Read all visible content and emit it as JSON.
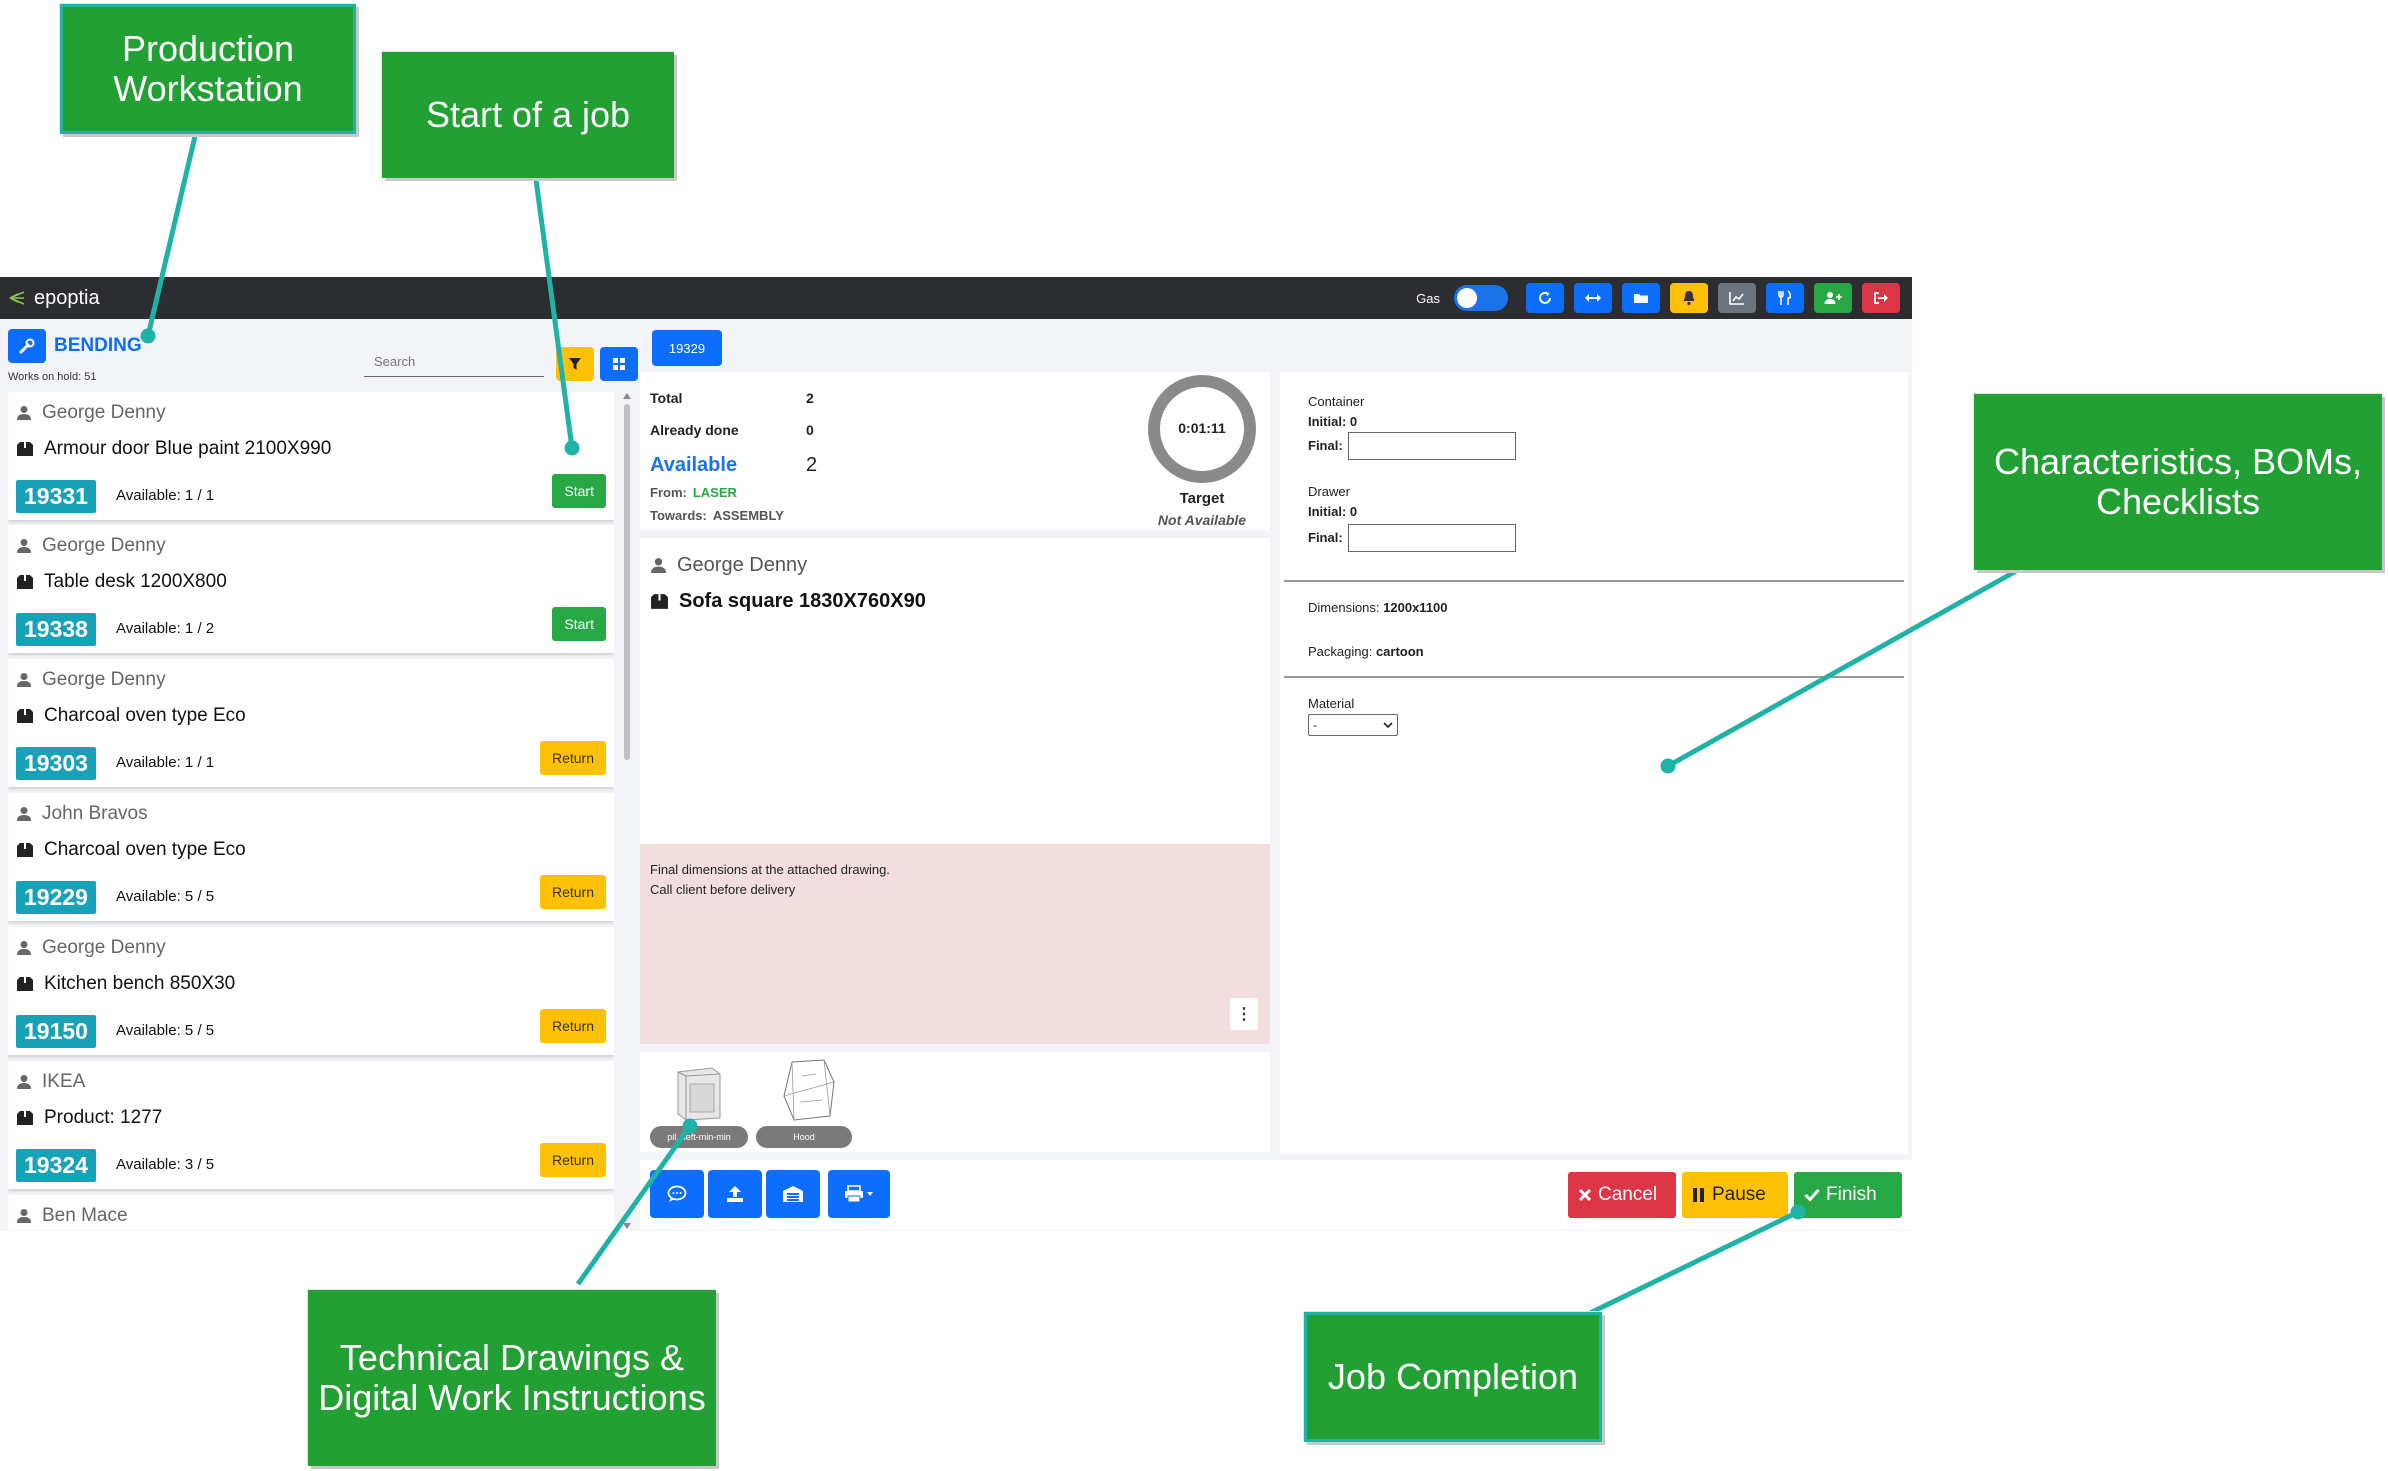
{
  "callouts": {
    "production_workstation": "Production Workstation",
    "start_of_job": "Start of a job",
    "characteristics": "Characteristics, BOMs, Checklists",
    "technical_drawings": "Technical Drawings & Digital Work Instructions",
    "job_completion": "Job Completion"
  },
  "navbar": {
    "brand": "epoptia",
    "gas_label": "Gas",
    "gas_toggle_on": true,
    "buttons": [
      {
        "icon": "refresh-icon",
        "color": "#0d6efd"
      },
      {
        "icon": "arrows-horizontal-icon",
        "color": "#0d6efd"
      },
      {
        "icon": "folder-icon",
        "color": "#0d6efd"
      },
      {
        "icon": "bell-icon",
        "color": "#ffc107"
      },
      {
        "icon": "chart-icon",
        "color": "#6c757d"
      },
      {
        "icon": "utensils-icon",
        "color": "#0d6efd"
      },
      {
        "icon": "user-plus-icon",
        "color": "#28a745"
      },
      {
        "icon": "sign-out-icon",
        "color": "#dc3545"
      }
    ]
  },
  "workstation": {
    "name": "BENDING",
    "on_hold": "Works on hold: 51",
    "search_placeholder": "Search"
  },
  "jobs": [
    {
      "client": "George Denny",
      "product": "Armour door Blue paint 2100X990",
      "id": "19331",
      "available": "Available: 1 / 1",
      "action": "Start"
    },
    {
      "client": "George Denny",
      "product": "Table desk 1200X800",
      "id": "19338",
      "available": "Available: 1 / 2",
      "action": "Start"
    },
    {
      "client": "George Denny",
      "product": "Charcoal oven type Eco",
      "id": "19303",
      "available": "Available: 1 / 1",
      "action": "Return"
    },
    {
      "client": "John Bravos",
      "product": "Charcoal oven type Eco",
      "id": "19229",
      "available": "Available: 5 / 5",
      "action": "Return"
    },
    {
      "client": "George Denny",
      "product": "Kitchen bench 850X30",
      "id": "19150",
      "available": "Available: 5 / 5",
      "action": "Return"
    },
    {
      "client": "IKEA",
      "product": "Product: 1277",
      "id": "19324",
      "available": "Available: 3 / 5",
      "action": "Return"
    },
    {
      "client": "Ben Mace",
      "product": "",
      "id": "",
      "available": "",
      "action": ""
    }
  ],
  "current": {
    "tab": "19329",
    "total_label": "Total",
    "total": "2",
    "done_label": "Already done",
    "done": "0",
    "available_label": "Available",
    "available": "2",
    "from_label": "From:",
    "from": "LASER",
    "towards_label": "Towards:",
    "towards": "ASSEMBLY",
    "timer": "0:01:11",
    "target_label": "Target",
    "target_value": "Not Available",
    "client": "George Denny",
    "product": "Sofa square 1830X760X90",
    "notes": [
      "Final dimensions at the attached drawing.",
      "Call client before delivery"
    ],
    "attachments": [
      {
        "label": "pil...left-min-min"
      },
      {
        "label": "Hood"
      }
    ]
  },
  "characteristics": {
    "container_label": "Container",
    "container_initial": "Initial: 0",
    "container_final_label": "Final:",
    "drawer_label": "Drawer",
    "drawer_initial": "Initial: 0",
    "drawer_final_label": "Final:",
    "dimensions_label": "Dimensions:",
    "dimensions_value": "1200x1100",
    "packaging_label": "Packaging:",
    "packaging_value": "cartoon",
    "material_label": "Material",
    "material_value": "-"
  },
  "actions": {
    "cancel": "Cancel",
    "pause": "Pause",
    "finish": "Finish"
  }
}
